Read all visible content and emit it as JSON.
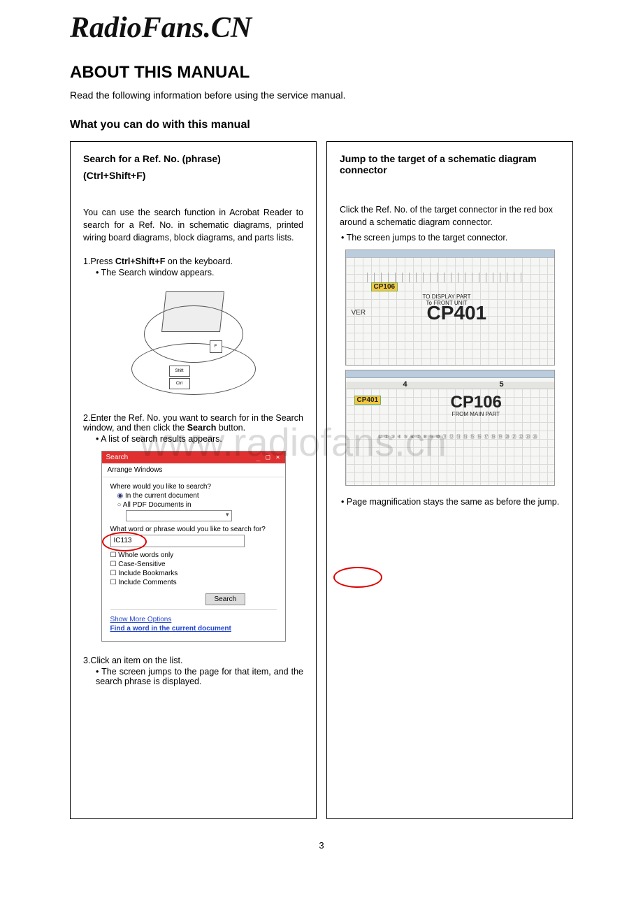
{
  "brand": "RadioFans.CN",
  "title": "ABOUT THIS MANUAL",
  "intro": "Read the following information before using the service manual.",
  "subheading": "What you can do with this manual",
  "watermark": "www.radiofans.cn",
  "page_number": "3",
  "left": {
    "title": "Search for a Ref. No. (phrase)",
    "subtitle": "(Ctrl+Shift+F)",
    "desc": "You can use the search function in Acrobat Reader to search for a Ref. No. in schematic diagrams, printed wiring board diagrams, block diagrams, and parts lists.",
    "step1_pre": "1.Press ",
    "step1_keys": "Ctrl+Shift+F",
    "step1_post": " on the keyboard.",
    "step1_bullet": "The Search window appears.",
    "laptop": {
      "shift": "Shift",
      "ctrl": "Ctrl",
      "f": "F"
    },
    "step2_pre": "2.Enter the Ref. No. you want to search for in the Search window, and then click the ",
    "step2_btn": "Search",
    "step2_post": " button.",
    "step2_bullet": "A list of search results appears.",
    "search_window": {
      "title": "Search",
      "win_ctrls": "_ □ ×",
      "arrange": "Arrange Windows",
      "where": "Where would you like to search?",
      "opt_current": "In the current document",
      "opt_all": "All PDF Documents in",
      "what": "What word or phrase would you like to search for?",
      "input_value": "IC113",
      "chk_whole": "Whole words only",
      "chk_case": "Case-Sensitive",
      "chk_book": "Include Bookmarks",
      "chk_comm": "Include Comments",
      "btn": "Search",
      "link_more": "Show More Options",
      "link_find": "Find a word in the current document"
    },
    "step3": "3.Click an item on the list.",
    "step3_bullet": "The screen jumps to the page for that item, and the search phrase is displayed."
  },
  "right": {
    "title": "Jump to the target of a schematic diagram connector",
    "desc": "Click the Ref. No. of the target connector in the red box around a schematic diagram connector.",
    "bullet1": "The screen jumps to the target connector.",
    "fig1": {
      "ver": "VER",
      "cp106": "CP106",
      "sub": "TO DISPLAY PART\nTo FRONT UNIT",
      "cp401": "CP401"
    },
    "fig2": {
      "num4": "4",
      "num5": "5",
      "cp401": "CP401",
      "cp106": "CP106",
      "sub": "FROM MAIN PART"
    },
    "bullet2": "Page magnification stays the same as before the jump."
  }
}
